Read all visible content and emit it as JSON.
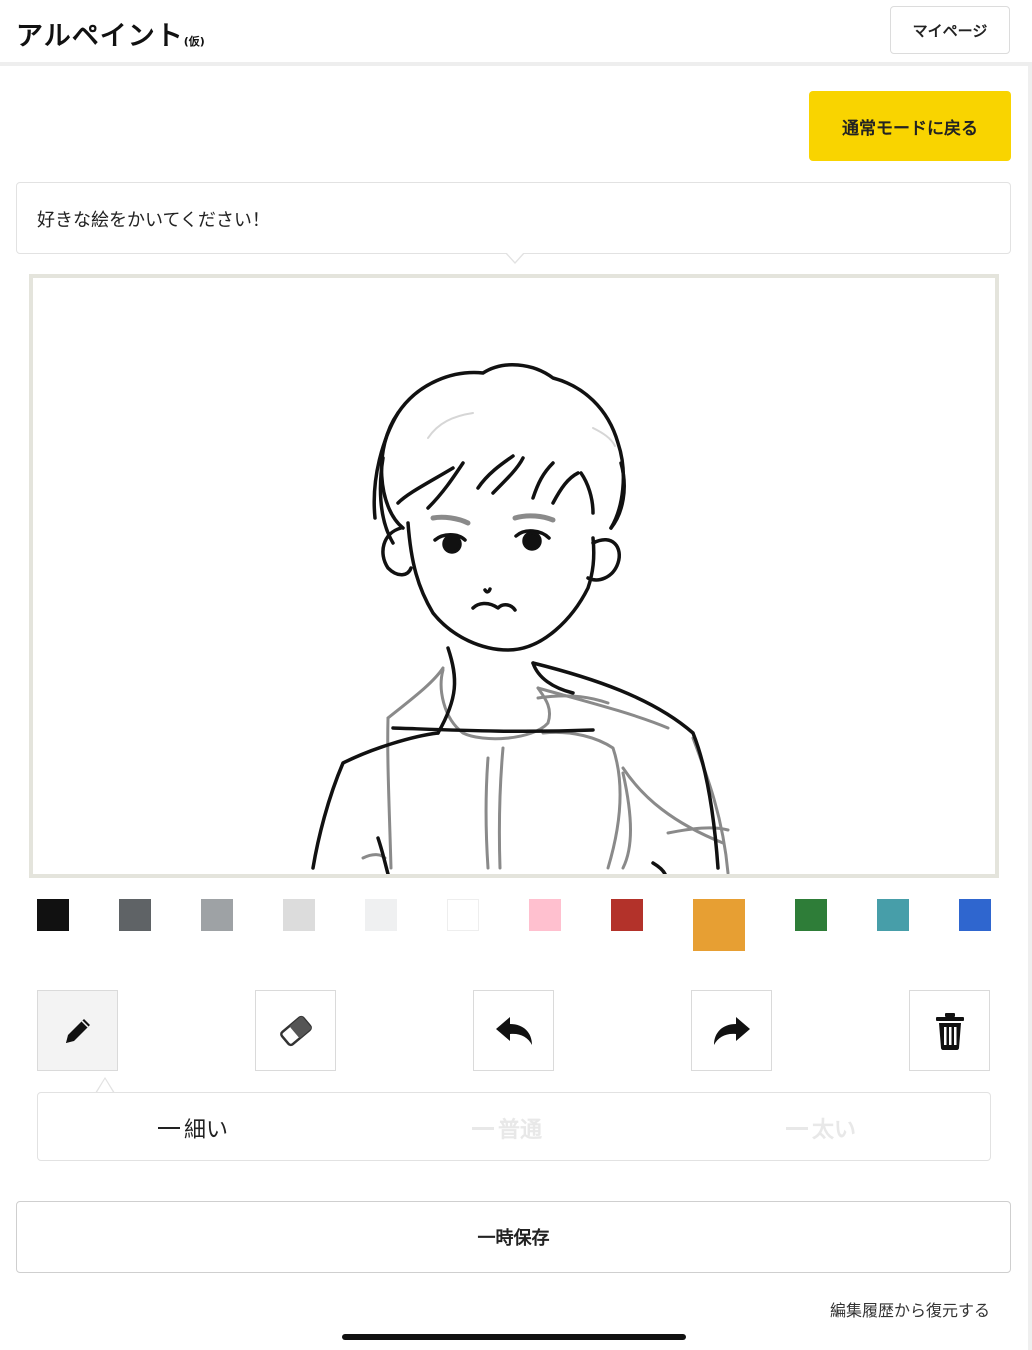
{
  "header": {
    "logo_main": "アルペイント",
    "logo_sub": "(仮)",
    "mypage_label": "マイページ"
  },
  "mode": {
    "normal_mode_label": "通常モードに戻る"
  },
  "prompt": {
    "text": "好きな絵をかいてください！"
  },
  "palette": {
    "colors": [
      "#111111",
      "#5f6366",
      "#9ea2a5",
      "#dcdcdc",
      "#eff0f1",
      "#ffffff",
      "#ffc0cf",
      "#b3322a",
      "#e79f33",
      "#2e7d38",
      "#479ea9",
      "#2f66cf"
    ],
    "selected_color": "#e79f33"
  },
  "tools": {
    "pen": "pencil-icon",
    "eraser": "eraser-icon",
    "undo": "undo-icon",
    "redo": "redo-icon",
    "clear": "trash-icon",
    "active_tool": "pen"
  },
  "stroke_width": {
    "thin": "細い",
    "normal": "普通",
    "thick": "太い",
    "selected": "thin"
  },
  "actions": {
    "save_label": "一時保存",
    "restore_label": "編集履歴から復元する"
  }
}
